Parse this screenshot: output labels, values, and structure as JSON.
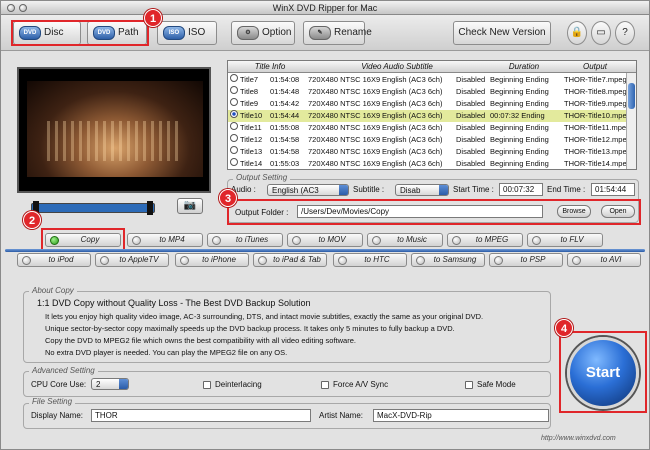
{
  "window": {
    "title": "WinX DVD Ripper for Mac"
  },
  "toolbar": {
    "disc": {
      "label": "Disc",
      "icon_text": "DVD"
    },
    "path": {
      "label": "Path",
      "icon_text": "DVD"
    },
    "iso": {
      "label": "ISO",
      "icon_text": "ISO"
    },
    "option": {
      "label": "Option"
    },
    "rename": {
      "label": "Rename"
    },
    "check_version": "Check New Version"
  },
  "markers": {
    "m1": "1",
    "m2": "2",
    "m3": "3",
    "m4": "4"
  },
  "titles_table": {
    "headers": [
      "Title Info",
      "Video Audio Subtitle",
      "Duration",
      "Output"
    ],
    "rows": [
      {
        "name": "Title7",
        "time": "01:54:08",
        "video": "720X480 NTSC 16X9",
        "audio": "English (AC3 6ch)",
        "sub": "Disabled",
        "duration": "Beginning Ending",
        "output": "THOR-Title7.mpeg"
      },
      {
        "name": "Title8",
        "time": "01:54:48",
        "video": "720X480 NTSC 16X9",
        "audio": "English (AC3 6ch)",
        "sub": "Disabled",
        "duration": "Beginning Ending",
        "output": "THOR-Title8.mpeg"
      },
      {
        "name": "Title9",
        "time": "01:54:42",
        "video": "720X480 NTSC 16X9",
        "audio": "English (AC3 6ch)",
        "sub": "Disabled",
        "duration": "Beginning Ending",
        "output": "THOR-Title9.mpeg"
      },
      {
        "name": "Title10",
        "time": "01:54:44",
        "video": "720X480 NTSC 16X9",
        "audio": "English (AC3 6ch)",
        "sub": "Disabled",
        "duration": "00:07:32 Ending",
        "output": "THOR-Title10.mpe",
        "selected": true
      },
      {
        "name": "Title11",
        "time": "01:55:08",
        "video": "720X480 NTSC 16X9",
        "audio": "English (AC3 6ch)",
        "sub": "Disabled",
        "duration": "Beginning Ending",
        "output": "THOR-Title11.mpe"
      },
      {
        "name": "Title12",
        "time": "01:54:58",
        "video": "720X480 NTSC 16X9",
        "audio": "English (AC3 6ch)",
        "sub": "Disabled",
        "duration": "Beginning Ending",
        "output": "THOR-Title12.mpe"
      },
      {
        "name": "Title13",
        "time": "01:54:58",
        "video": "720X480 NTSC 16X9",
        "audio": "English (AC3 6ch)",
        "sub": "Disabled",
        "duration": "Beginning Ending",
        "output": "THOR-Title13.mpe"
      },
      {
        "name": "Title14",
        "time": "01:55:03",
        "video": "720X480 NTSC 16X9",
        "audio": "English (AC3 6ch)",
        "sub": "Disabled",
        "duration": "Beginning Ending",
        "output": "THOR-Title14.mpe"
      }
    ]
  },
  "output_setting": {
    "group_label": "Output Setting",
    "audio_label": "Audio :",
    "audio_value": "English (AC3",
    "subtitle_label": "Subtitle :",
    "subtitle_value": "Disab",
    "start_label": "Start Time :",
    "start_value": "00:07:32",
    "end_label": "End Time :",
    "end_value": "01:54:44",
    "folder_label": "Output Folder :",
    "folder_value": "/Users/Dev/Movies/Copy",
    "browse": "Browse",
    "open": "Open"
  },
  "tabs_row1": [
    "Copy",
    "to MP4",
    "to iTunes",
    "to MOV",
    "to Music",
    "to MPEG",
    "to FLV"
  ],
  "tabs_row2": [
    "to iPod",
    "to AppleTV",
    "to iPhone",
    "to iPad & Tab",
    "to HTC",
    "to Samsung",
    "to PSP",
    "to AVI"
  ],
  "about": {
    "group_label": "About Copy",
    "title": "1:1 DVD Copy without Quality Loss - The Best DVD Backup Solution",
    "lines": [
      "It lets you enjoy high quality video image, AC-3 surrounding, DTS, and intact movie subtitles, exactly the same as your original DVD.",
      "Unique sector-by-sector copy maximally speeds up the DVD backup process. It takes only 5 minutes to fully backup a DVD.",
      "Copy the DVD to MPEG2 file which owns the best compatibility with all video editing software.",
      "No extra DVD player is needed. You can play the MPEG2 file on any OS."
    ]
  },
  "advanced": {
    "group_label": "Advanced Setting",
    "cpu_label": "CPU Core Use:",
    "cpu_value": "2",
    "deinterlacing": "Deinterlacing",
    "force_sync": "Force A/V Sync",
    "safe_mode": "Safe Mode"
  },
  "file_setting": {
    "group_label": "File Setting",
    "display_label": "Display Name:",
    "display_value": "THOR",
    "artist_label": "Artist Name:",
    "artist_value": "MacX-DVD-Rip"
  },
  "start_button": "Start",
  "footer_url": "http://www.winxdvd.com"
}
